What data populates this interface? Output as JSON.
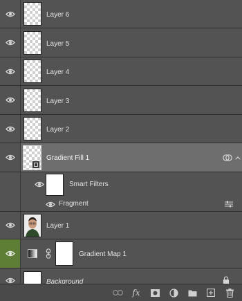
{
  "layers": [
    {
      "name": "Layer 6"
    },
    {
      "name": "Layer 5"
    },
    {
      "name": "Layer 4"
    },
    {
      "name": "Layer 3"
    },
    {
      "name": "Layer 2"
    },
    {
      "name": "Gradient Fill 1"
    },
    {
      "name": "Smart Filters"
    },
    {
      "name": "Fragment"
    },
    {
      "name": "Layer 1"
    },
    {
      "name": "Gradient Map 1"
    },
    {
      "name": "Background"
    }
  ],
  "colors": {
    "panel_bg": "#535353",
    "selected_row": "#6e6e6e",
    "visibility_highlight": "#5f7e35"
  },
  "toolbar": {
    "fx_label": "fx",
    "icons": [
      "link-layers-icon",
      "fx-icon",
      "add-mask-icon",
      "adjustment-layer-icon",
      "new-group-icon",
      "new-layer-icon",
      "trash-icon"
    ]
  }
}
